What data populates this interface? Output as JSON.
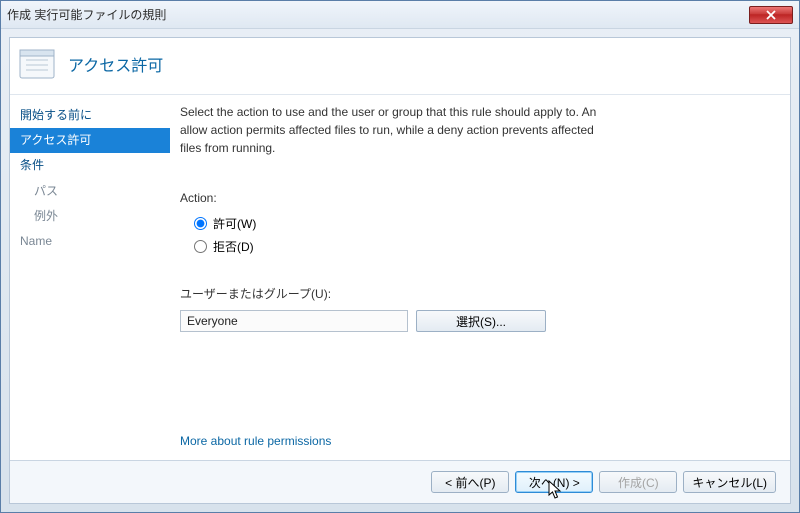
{
  "window": {
    "title": "作成 実行可能ファイルの規則"
  },
  "header": {
    "title": "アクセス許可"
  },
  "sidebar": {
    "items": [
      {
        "label": "開始する前に",
        "selected": false
      },
      {
        "label": "アクセス許可",
        "selected": true
      },
      {
        "label": "条件",
        "selected": false
      },
      {
        "label": "パス",
        "selected": false,
        "sub": true
      },
      {
        "label": "例外",
        "selected": false,
        "sub": true
      },
      {
        "label": "Name",
        "selected": false
      }
    ]
  },
  "main": {
    "description": "Select the action to use and the user or group that this rule should apply to. An allow action permits affected files to run, while a deny action prevents affected files from running.",
    "action_label": "Action:",
    "radio_allow": "許可(W)",
    "radio_deny": "拒否(D)",
    "ug_label": "ユーザーまたはグループ(U):",
    "ug_value": "Everyone",
    "select_label": "選択(S)...",
    "more_link": "More about rule permissions"
  },
  "footer": {
    "back": "< 前へ(P)",
    "next": "次へ(N) >",
    "create": "作成(C)",
    "cancel": "キャンセル(L)"
  }
}
